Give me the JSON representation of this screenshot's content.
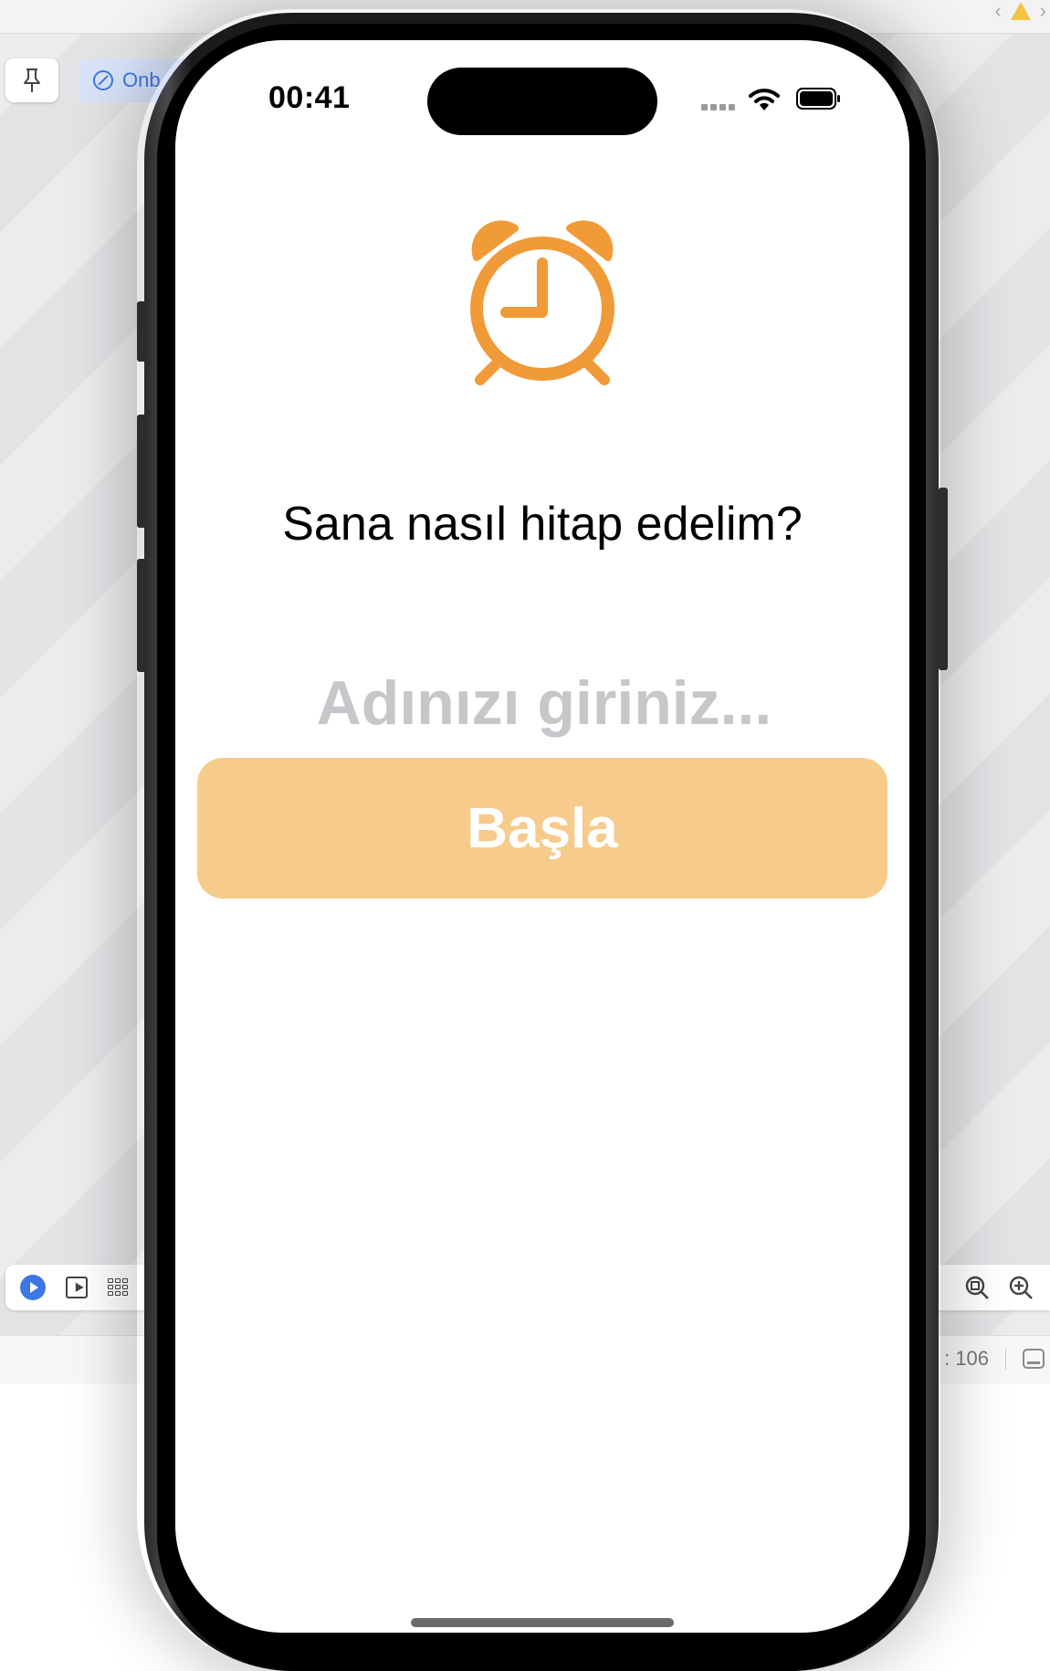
{
  "xcode": {
    "onb_chip_label": "Onb",
    "status_value": ": 106",
    "icons": {
      "pin": "pin-icon",
      "warning": "warning-icon",
      "preview_play": "play-icon",
      "selectable": "select-icon",
      "variants": "grid-icon",
      "zoom_fit": "zoom-fit-icon",
      "zoom_in": "zoom-in-icon",
      "panel": "panel-toggle-icon"
    },
    "accent_color": "#3e76e6"
  },
  "phone": {
    "status_bar": {
      "time": "00:41"
    },
    "screen": {
      "icon": "alarm-clock-icon",
      "icon_color": "#f19a38",
      "title": "Sana nasıl hitap edelim?",
      "name_input": {
        "placeholder": "Adınızı giriniz...",
        "value": ""
      },
      "start_button": {
        "label": "Başla",
        "color": "#f6cb8b"
      }
    }
  }
}
